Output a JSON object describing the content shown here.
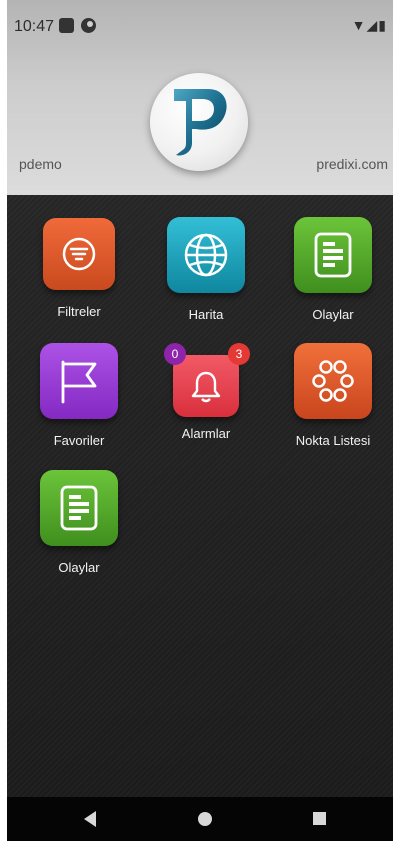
{
  "status_bar": {
    "time": "10:47",
    "right_icons": "▼◢▮"
  },
  "header": {
    "left_text": "pdemo",
    "right_text": "predixi.com",
    "logo_icon": "predixi-logo-icon"
  },
  "tiles": [
    {
      "label": "Filtreler",
      "icon": "filter-icon",
      "color": "#e2572a"
    },
    {
      "label": "Harita",
      "icon": "globe-icon",
      "color": "#1aa1bc"
    },
    {
      "label": "Olaylar",
      "icon": "list-icon",
      "color": "#56ad2b"
    },
    {
      "label": "Favoriler",
      "icon": "flag-icon",
      "color": "#9a3cd6"
    },
    {
      "label": "Alarmlar",
      "icon": "bell-icon",
      "color": "#e8414f"
    },
    {
      "label": "Nokta Listesi",
      "icon": "points-icon",
      "color": "#e05d2c"
    },
    {
      "label": "Olaylar",
      "icon": "list-icon",
      "color": "#56ad2b"
    }
  ],
  "badges": {
    "alarm_left": "0",
    "alarm_right": "3",
    "left_color": "#8e24aa",
    "right_color": "#e53935"
  },
  "navbar": {
    "back_icon": "back-icon",
    "home_icon": "home-icon",
    "recents_icon": "recents-icon"
  }
}
